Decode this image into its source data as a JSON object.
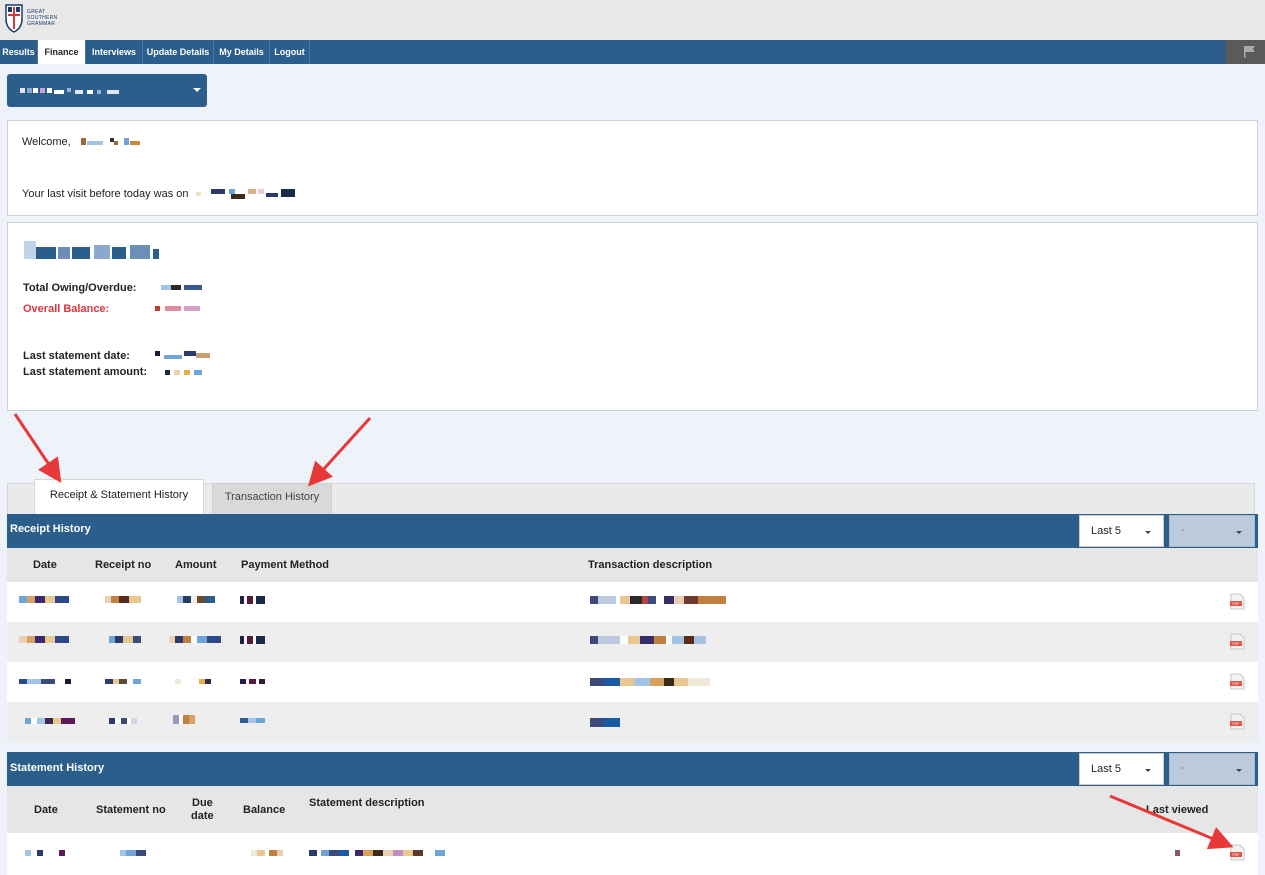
{
  "app": {
    "logo": {
      "text_line1": "GREAT",
      "text_line2": "SOUTHERN",
      "text_line3": "GRAMMAR"
    }
  },
  "nav": {
    "items": [
      "Results",
      "Finance",
      "Interviews",
      "Update Details",
      "My Details",
      "Logout"
    ],
    "active": "Finance"
  },
  "welcome": {
    "greeting": "Welcome,",
    "last_visit": "Your last visit before today was on"
  },
  "account": {
    "total_owing_label": "Total Owing/Overdue:",
    "overall_balance_label": "Overall Balance:",
    "last_statement_date_label": "Last statement date:",
    "last_statement_amount_label": "Last statement amount:"
  },
  "tabs": {
    "receipt_statement": "Receipt & Statement History",
    "transaction": "Transaction History"
  },
  "receipt_history": {
    "title": "Receipt History",
    "filter": "Last 5",
    "secondary_filter": "-",
    "columns": [
      "Date",
      "Receipt no",
      "Amount",
      "Payment Method",
      "Transaction description"
    ]
  },
  "statement_history": {
    "title": "Statement History",
    "filter": "Last 5",
    "secondary_filter": "-",
    "columns": [
      "Date",
      "Statement no",
      "Due",
      "date",
      "Balance",
      "Statement description",
      "Last viewed"
    ]
  },
  "colors": {
    "brand_blue": "#2c5e8c",
    "alert_red": "#d9363e",
    "annotation_arrow": "#e8393a",
    "pdf_icon": "#e2554a"
  },
  "icons": {
    "dropdown": "chevron-down-icon",
    "pdf": "pdf-file-icon",
    "flag": "flag-icon"
  }
}
